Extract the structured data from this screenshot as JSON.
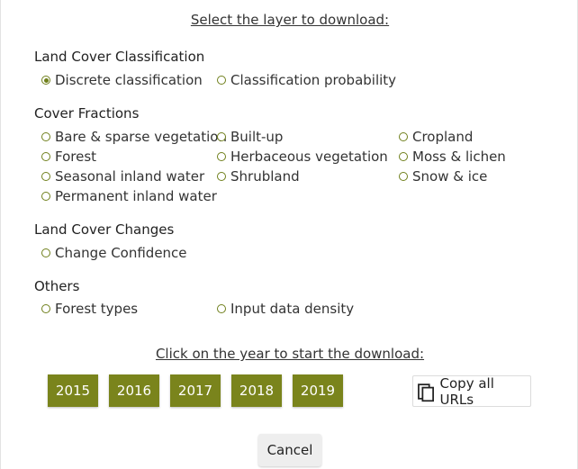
{
  "header": {
    "select_layer": "Select the layer to download:"
  },
  "sections": {
    "land_cover_classification": {
      "title": "Land Cover Classification",
      "options": [
        "Discrete classification",
        "Classification probability"
      ]
    },
    "cover_fractions": {
      "title": "Cover Fractions",
      "options": [
        "Bare & sparse vegetation",
        "Built-up",
        "Cropland",
        "Forest",
        "Herbaceous vegetation",
        "Moss & lichen",
        "Seasonal inland water",
        "Shrubland",
        "Snow & ice",
        "Permanent inland water"
      ]
    },
    "land_cover_changes": {
      "title": "Land Cover Changes",
      "options": [
        "Change Confidence"
      ]
    },
    "others": {
      "title": "Others",
      "options": [
        "Forest types",
        "Input data density"
      ]
    }
  },
  "selected_option": "Discrete classification",
  "download": {
    "instruction": "Click on the year to start the download:",
    "years": [
      "2015",
      "2016",
      "2017",
      "2018",
      "2019"
    ],
    "copy_label": "Copy all URLs",
    "copy_icon": "copy-icon"
  },
  "cancel_label": "Cancel",
  "colors": {
    "accent": "#7a841c",
    "radio": "#6f7f1b",
    "cancel_bg": "#eeeeee"
  }
}
